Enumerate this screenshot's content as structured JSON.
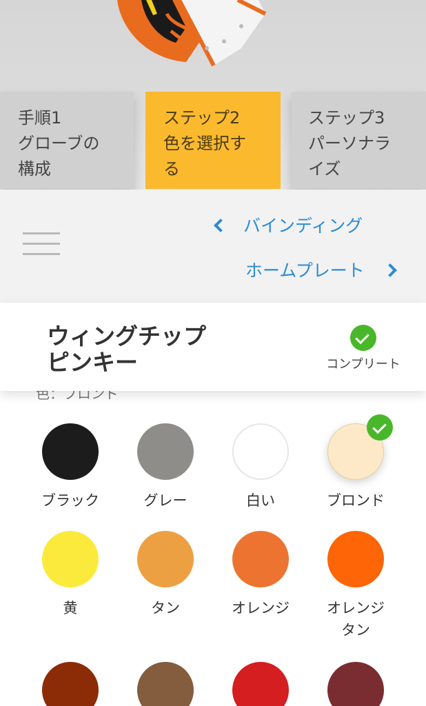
{
  "steps": [
    {
      "line1": "手順1",
      "line2": "グローブの",
      "line3": "構成"
    },
    {
      "line1": "ステップ2",
      "line2": "色を選択す",
      "line3": "る"
    },
    {
      "line1": "ステップ3",
      "line2": "パーソナラ",
      "line3": "イズ"
    }
  ],
  "component_nav": {
    "prev_label": "バインディング",
    "next_label": "ホームプレート"
  },
  "part": {
    "title": "ウィングチップピンキー",
    "status_label": "コンプリート"
  },
  "color_section_label": "色：ブロンド",
  "colors": [
    {
      "name": "ブラック",
      "hex": "#1c1c1c"
    },
    {
      "name": "グレー",
      "hex": "#8f8d89"
    },
    {
      "name": "白い",
      "hex": "#ffffff"
    },
    {
      "name": "ブロンド",
      "hex": "#fde9c8",
      "selected": true
    },
    {
      "name": "黄",
      "hex": "#fbea3c"
    },
    {
      "name": "タン",
      "hex": "#eda042"
    },
    {
      "name": "オレンジ",
      "hex": "#ec7430"
    },
    {
      "name": "オレンジ タン",
      "line1": "オレンジ",
      "line2": "タン",
      "hex": "#fd6507"
    },
    {
      "name": "",
      "hex": "#8b2c06"
    },
    {
      "name": "",
      "hex": "#845c3e"
    },
    {
      "name": "",
      "hex": "#d41e20"
    },
    {
      "name": "",
      "hex": "#7a2d30"
    }
  ],
  "accent_colors": {
    "active_step": "#fbb92e",
    "link": "#2b8bd6",
    "check": "#49b72a"
  }
}
